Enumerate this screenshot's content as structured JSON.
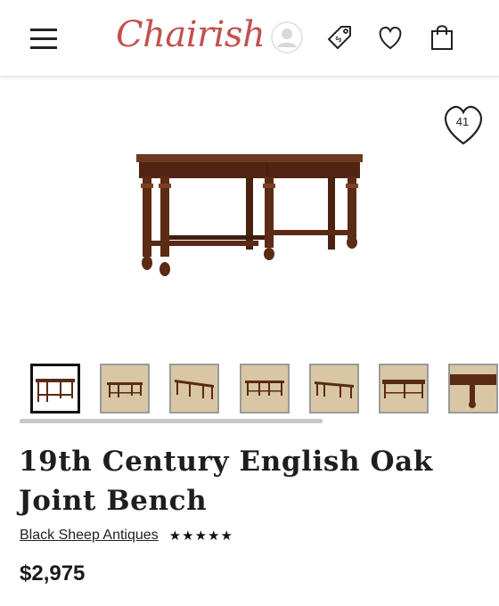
{
  "header": {
    "logo": "Chairish",
    "icons": [
      "menu-icon",
      "avatar-icon",
      "price-tag-icon",
      "heart-icon",
      "shopping-bag-icon"
    ]
  },
  "product": {
    "favorites_count": "41",
    "title": "19th Century English Oak Joint Bench",
    "seller": "Black Sheep Antiques",
    "rating": "★★★★★",
    "price": "$2,975"
  },
  "gallery": {
    "thumbnails": 7,
    "active_index": 0
  },
  "colors": {
    "brand": "#c1514e",
    "wood": "#5a2a14",
    "thumb_bg": "#d8c6a4"
  }
}
